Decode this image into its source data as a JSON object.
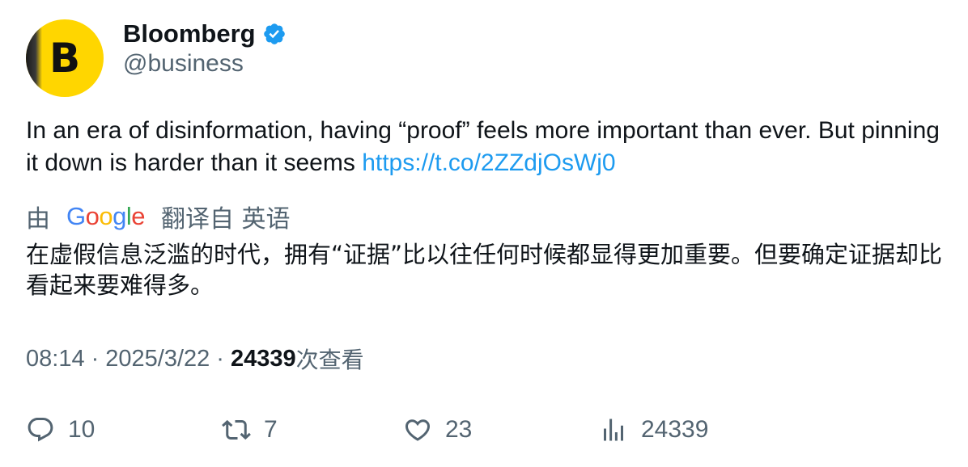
{
  "author": {
    "display_name": "Bloomberg",
    "handle": "@business",
    "avatar_letter": "B",
    "verified": true,
    "verified_color": "#1d9bf0",
    "avatar_color": "#ffd600"
  },
  "tweet": {
    "text": "In an era of disinformation, having “proof” feels more important than ever. But pinning it down is harder than it seems ",
    "link": "https://t.co/2ZZdjOsWj0",
    "link_color": "#1d9bf0"
  },
  "translation": {
    "prefix": "由",
    "provider_letters": [
      "G",
      "o",
      "o",
      "g",
      "l",
      "e"
    ],
    "suffix": "翻译自 英语",
    "text": "在虚假信息泛滥的时代，拥有“证据”比以往任何时候都显得更加重要。但要确定证据却比看起来要难得多。"
  },
  "meta": {
    "time": "08:14",
    "separator": "·",
    "date": "2025/3/22",
    "views": "24339",
    "views_label": "次查看"
  },
  "actions": {
    "reply": {
      "icon": "reply-icon",
      "count": "10"
    },
    "retweet": {
      "icon": "retweet-icon",
      "count": "7"
    },
    "like": {
      "icon": "heart-icon",
      "count": "23"
    },
    "views": {
      "icon": "analytics-icon",
      "count": "24339"
    }
  }
}
